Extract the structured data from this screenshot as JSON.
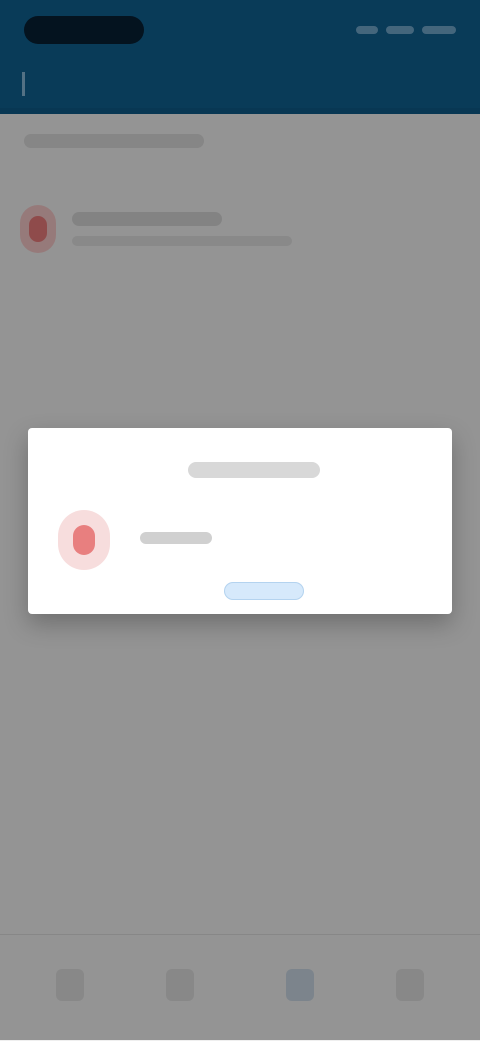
{
  "status_bar": {
    "time": "",
    "icons": [
      "signal-icon",
      "wifi-icon",
      "battery-icon"
    ]
  },
  "header": {
    "accent_icon": "menu-icon"
  },
  "content": {
    "section_title": "",
    "row": {
      "title": "",
      "subtitle": ""
    }
  },
  "dialog": {
    "title": "",
    "message": "",
    "button_label": ""
  },
  "bottom_nav": {
    "items": [
      {
        "name": "nav-item-1"
      },
      {
        "name": "nav-item-2"
      },
      {
        "name": "nav-item-3"
      },
      {
        "name": "nav-item-4"
      }
    ],
    "active_index": 2
  },
  "colors": {
    "primary": "#0f5f8f",
    "overlay": "#000000",
    "danger": "#e35f5f",
    "link": "#2e7dc3"
  }
}
